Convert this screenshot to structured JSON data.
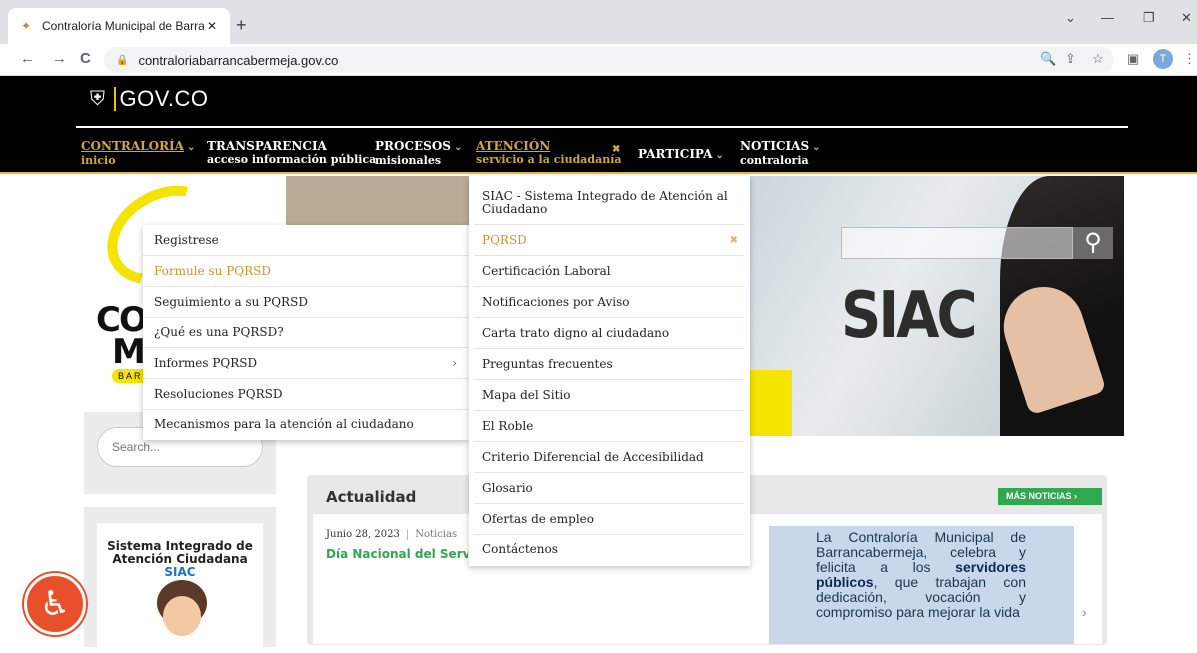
{
  "browser": {
    "tab_title": "Contraloría Municipal de Barranc",
    "tab_close": "✕",
    "new_tab": "+",
    "url": "contraloriabarrancabermeja.gov.co",
    "profile_initial": "T",
    "window_controls": {
      "collapse": "⌄",
      "minimize": "—",
      "restore": "❐",
      "close": "✕"
    },
    "nav": {
      "back": "←",
      "forward": "→",
      "reload": "C"
    },
    "toolbar_icons": {
      "zoom": "🔍",
      "share": "⇪",
      "star": "☆",
      "sidepanel": "▣",
      "menu": "⋮"
    }
  },
  "site": {
    "logo_text": "GOV.CO",
    "nav": [
      {
        "label": "CONTRALORÍA",
        "sub": "inicio",
        "chevron": "⌄"
      },
      {
        "label": "TRANSPARENCIA",
        "sub": "acceso información pública"
      },
      {
        "label": "PROCESOS",
        "sub": "misionales",
        "chevron": "⌄"
      },
      {
        "label": "ATENCIÓN",
        "sub": "servicio a la ciudadanía",
        "close": "✖"
      },
      {
        "label": "PARTICIPA",
        "chevron": "⌄"
      },
      {
        "label": "NOTICIAS",
        "sub": "contraloria",
        "chevron": "⌄"
      }
    ],
    "brand": {
      "con": "CON",
      "mu": "MU",
      "bar": "BAR"
    },
    "search_placeholder": "Search...",
    "siac_card": {
      "line1": "Sistema Integrado de",
      "line2": "Atención Ciudadana",
      "siac": "SIAC"
    },
    "accessibility": "♿"
  },
  "hero": {
    "siac_word": "SIAC",
    "search_icon": "⚲"
  },
  "atencion_menu": [
    "SIAC - Sistema Integrado de Atención al Ciudadano",
    "PQRSD",
    "Certificación Laboral",
    "Notificaciones por Aviso",
    "Carta trato digno al ciudadano",
    "Preguntas frecuentes",
    "Mapa del Sitio",
    "El Roble",
    "Criterio Diferencial de Accesibilidad",
    "Glosario",
    "Ofertas de empleo",
    "Contáctenos"
  ],
  "atencion_menu_active_close": "✖",
  "pqrsd_submenu": [
    "Registrese",
    "Formule su PQRSD",
    "Seguimiento a su PQRSD",
    "¿Qué es una PQRSD?",
    "Informes PQRSD",
    "Resoluciones PQRSD",
    "Mecanismos para la atención al ciudadano"
  ],
  "pqrsd_submenu_arrow": "›",
  "news": {
    "section_title": "Actualidad",
    "more_button": "MÁS NOTICIAS  ›",
    "date": "Junio 28, 2023",
    "category": "Noticias",
    "headline": "Día Nacional del Servidor Público",
    "body_1": "La Contraloría Municipal de Barrancabermeja, celebra y felicita a los ",
    "body_bold_1": "servidores",
    "body_bold_2": "públicos",
    "body_2": ", que trabajan con dedicación, vocación y compromiso para mejorar la vida",
    "next": "›",
    "sep": "|"
  }
}
